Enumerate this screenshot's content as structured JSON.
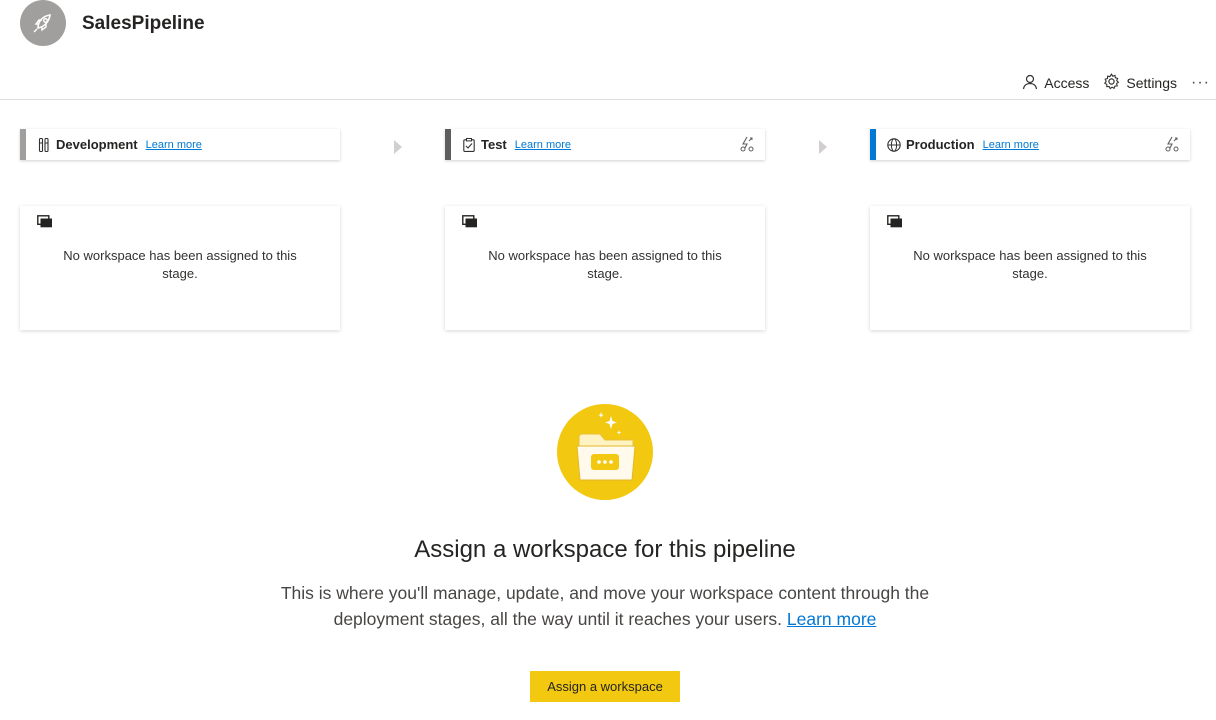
{
  "header": {
    "pipeline_name": "SalesPipeline",
    "pipeline_icon": "rocket-icon",
    "actions": {
      "access_label": "Access",
      "settings_label": "Settings",
      "more_label": "···"
    }
  },
  "stages": [
    {
      "name": "Development",
      "icon": "tools-icon",
      "learn_more": "Learn more",
      "accent_color": "#a19f9d",
      "empty_text": "No workspace has been assigned to this stage."
    },
    {
      "name": "Test",
      "icon": "clipboard-check-icon",
      "learn_more": "Learn more",
      "accent_color": "#605e5c",
      "empty_text": "No workspace has been assigned to this stage."
    },
    {
      "name": "Production",
      "icon": "globe-icon",
      "learn_more": "Learn more",
      "accent_color": "#0078d4",
      "empty_text": "No workspace has been assigned to this stage."
    }
  ],
  "empty_state": {
    "title": "Assign a workspace for this pipeline",
    "description": "This is where you'll manage, update, and move your workspace content through the deployment stages, all the way until it reaches your users.",
    "learn_more": "Learn more",
    "button_label": "Assign a workspace",
    "accent_color": "#f2c811"
  }
}
